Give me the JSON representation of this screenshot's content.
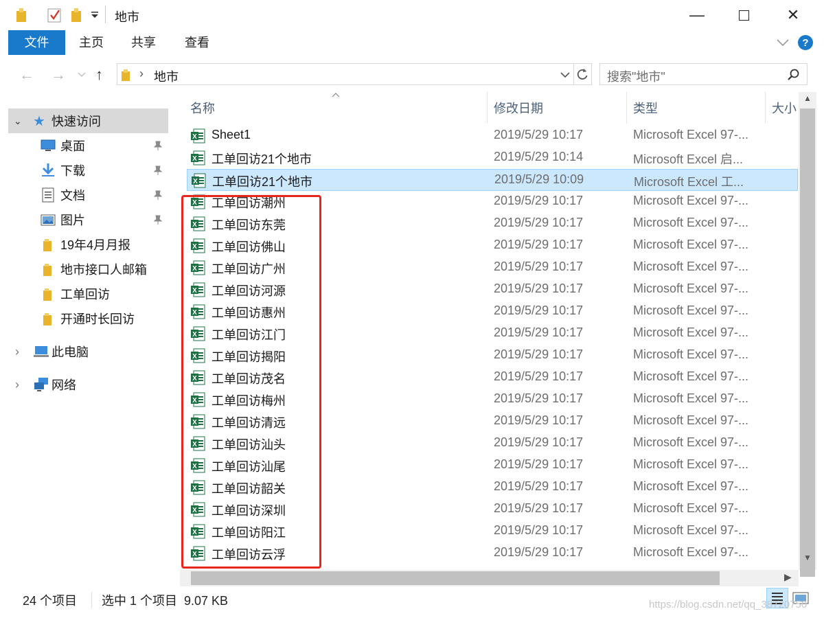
{
  "window": {
    "title": "地市"
  },
  "ribbon": {
    "tabs": [
      "文件",
      "主页",
      "共享",
      "查看"
    ]
  },
  "address": {
    "path": "地市",
    "search_placeholder": "搜索\"地市\""
  },
  "nav": {
    "quick_access": "快速访问",
    "items": [
      {
        "label": "桌面",
        "icon": "desktop-icon",
        "pinned": true
      },
      {
        "label": "下载",
        "icon": "download-icon",
        "pinned": true
      },
      {
        "label": "文档",
        "icon": "document-icon",
        "pinned": true
      },
      {
        "label": "图片",
        "icon": "picture-icon",
        "pinned": true
      },
      {
        "label": "19年4月月报",
        "icon": "folder-icon",
        "pinned": false
      },
      {
        "label": "地市接口人邮箱",
        "icon": "folder-icon",
        "pinned": false
      },
      {
        "label": "工单回访",
        "icon": "folder-icon",
        "pinned": false
      },
      {
        "label": "开通时长回访",
        "icon": "folder-icon",
        "pinned": false
      }
    ],
    "this_pc": "此电脑",
    "network": "网络"
  },
  "columns": {
    "name": "名称",
    "date": "修改日期",
    "type": "类型",
    "size": "大小"
  },
  "files": [
    {
      "name": "Sheet1",
      "date": "2019/5/29 10:17",
      "type": "Microsoft Excel 97-...",
      "selected": false
    },
    {
      "name": "工单回访21个地市",
      "date": "2019/5/29 10:14",
      "type": "Microsoft Excel 启...",
      "selected": false
    },
    {
      "name": "工单回访21个地市",
      "date": "2019/5/29 10:09",
      "type": "Microsoft Excel 工...",
      "selected": true
    },
    {
      "name": "工单回访潮州",
      "date": "2019/5/29 10:17",
      "type": "Microsoft Excel 97-...",
      "selected": false
    },
    {
      "name": "工单回访东莞",
      "date": "2019/5/29 10:17",
      "type": "Microsoft Excel 97-...",
      "selected": false
    },
    {
      "name": "工单回访佛山",
      "date": "2019/5/29 10:17",
      "type": "Microsoft Excel 97-...",
      "selected": false
    },
    {
      "name": "工单回访广州",
      "date": "2019/5/29 10:17",
      "type": "Microsoft Excel 97-...",
      "selected": false
    },
    {
      "name": "工单回访河源",
      "date": "2019/5/29 10:17",
      "type": "Microsoft Excel 97-...",
      "selected": false
    },
    {
      "name": "工单回访惠州",
      "date": "2019/5/29 10:17",
      "type": "Microsoft Excel 97-...",
      "selected": false
    },
    {
      "name": "工单回访江门",
      "date": "2019/5/29 10:17",
      "type": "Microsoft Excel 97-...",
      "selected": false
    },
    {
      "name": "工单回访揭阳",
      "date": "2019/5/29 10:17",
      "type": "Microsoft Excel 97-...",
      "selected": false
    },
    {
      "name": "工单回访茂名",
      "date": "2019/5/29 10:17",
      "type": "Microsoft Excel 97-...",
      "selected": false
    },
    {
      "name": "工单回访梅州",
      "date": "2019/5/29 10:17",
      "type": "Microsoft Excel 97-...",
      "selected": false
    },
    {
      "name": "工单回访清远",
      "date": "2019/5/29 10:17",
      "type": "Microsoft Excel 97-...",
      "selected": false
    },
    {
      "name": "工单回访汕头",
      "date": "2019/5/29 10:17",
      "type": "Microsoft Excel 97-...",
      "selected": false
    },
    {
      "name": "工单回访汕尾",
      "date": "2019/5/29 10:17",
      "type": "Microsoft Excel 97-...",
      "selected": false
    },
    {
      "name": "工单回访韶关",
      "date": "2019/5/29 10:17",
      "type": "Microsoft Excel 97-...",
      "selected": false
    },
    {
      "name": "工单回访深圳",
      "date": "2019/5/29 10:17",
      "type": "Microsoft Excel 97-...",
      "selected": false
    },
    {
      "name": "工单回访阳江",
      "date": "2019/5/29 10:17",
      "type": "Microsoft Excel 97-...",
      "selected": false
    },
    {
      "name": "工单回访云浮",
      "date": "2019/5/29 10:17",
      "type": "Microsoft Excel 97-...",
      "selected": false
    }
  ],
  "status": {
    "count": "24 个项目",
    "selection": "选中 1 个项目  9.07 KB"
  },
  "watermark": "https://blog.csdn.net/qq_38720750",
  "colors": {
    "accent": "#1979ca",
    "selection_bg": "#cce8ff",
    "highlight": "#e8261c",
    "excel_green": "#1e7145"
  }
}
